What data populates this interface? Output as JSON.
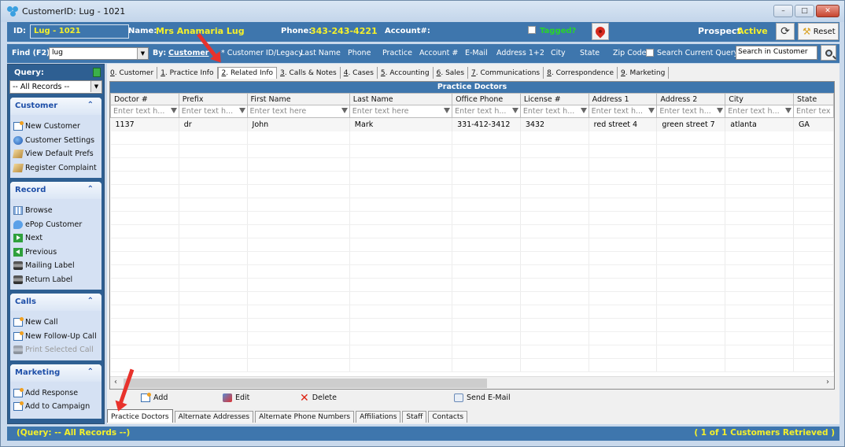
{
  "window": {
    "title": "CustomerID: Lug - 1021",
    "buttons": {
      "minimize": "–",
      "maximize": "□",
      "close": "✕"
    }
  },
  "infobar": {
    "id_label": "ID:",
    "id_value": "Lug - 1021",
    "name_label": "Name:",
    "name_value": "Mrs Anamaria Lug",
    "phone_label": "Phone:",
    "phone_value": "343-243-4221",
    "account_label": "Account#:",
    "account_value": "",
    "tagged_label": "Tagged?",
    "tagged_checked": false,
    "prospect_label": "Prospect",
    "status_value": "Active",
    "refresh_glyph": "⟳",
    "reset_label": "Reset"
  },
  "findbar": {
    "find_label": "Find (F2)",
    "find_value": "lug",
    "by_label": "By:",
    "by_value": "Customer",
    "fields": [
      "* Customer ID/Legacy",
      "Last Name",
      "Phone",
      "Practice",
      "Account #",
      "E-Mail",
      "Address 1+2",
      "City",
      "State",
      "Zip Code"
    ],
    "search_current_query_label": "Search Current Query",
    "search_current_query_checked": false,
    "search_value": "Search in Customer"
  },
  "sidebar": {
    "query_label": "Query:",
    "query_value": "-- All Records --",
    "groups": [
      {
        "title": "Customer",
        "items": [
          {
            "label": "New Customer",
            "icon": "new-icon"
          },
          {
            "label": "Customer Settings",
            "icon": "globe-icon"
          },
          {
            "label": "View Default Prefs",
            "icon": "prefs-icon"
          },
          {
            "label": "Register Complaint",
            "icon": "complaint-icon"
          }
        ]
      },
      {
        "title": "Record",
        "items": [
          {
            "label": "Browse",
            "icon": "grid-icon"
          },
          {
            "label": "ePop Customer",
            "icon": "chat-bubble-icon"
          },
          {
            "label": "Next",
            "icon": "next-icon"
          },
          {
            "label": "Previous",
            "icon": "previous-icon"
          },
          {
            "label": "Mailing Label",
            "icon": "printer-icon"
          },
          {
            "label": "Return Label",
            "icon": "printer-icon"
          }
        ]
      },
      {
        "title": "Calls",
        "items": [
          {
            "label": "New Call",
            "icon": "new-icon"
          },
          {
            "label": "New Follow-Up Call",
            "icon": "new-icon"
          },
          {
            "label": "Print Selected Call",
            "icon": "printer-icon",
            "disabled": true
          }
        ]
      },
      {
        "title": "Marketing",
        "items": [
          {
            "label": "Add Response",
            "icon": "new-icon"
          },
          {
            "label": "Add to Campaign",
            "icon": "new-icon"
          }
        ]
      }
    ]
  },
  "tabs": [
    {
      "key": "0",
      "label": ". Customer"
    },
    {
      "key": "1",
      "label": ". Practice Info"
    },
    {
      "key": "2",
      "label": ". Related Info",
      "active": true
    },
    {
      "key": "3",
      "label": ". Calls & Notes"
    },
    {
      "key": "4",
      "label": ". Cases"
    },
    {
      "key": "5",
      "label": ". Accounting"
    },
    {
      "key": "6",
      "label": ". Sales"
    },
    {
      "key": "7",
      "label": ". Communications"
    },
    {
      "key": "8",
      "label": ". Correspondence"
    },
    {
      "key": "9",
      "label": ". Marketing"
    }
  ],
  "grid": {
    "title": "Practice Doctors",
    "columns": [
      "Doctor #",
      "Prefix",
      "First Name",
      "Last Name",
      "Office Phone",
      "License #",
      "Address 1",
      "Address 2",
      "City",
      "State"
    ],
    "filters": [
      "Enter text h...",
      "Enter text h...",
      "Enter text here",
      "Enter text here",
      "Enter text h...",
      "Enter text h...",
      "Enter text h...",
      "Enter text h...",
      "Enter text h...",
      "Enter tex"
    ],
    "rows": [
      [
        "1137",
        "dr",
        "John",
        "Mark",
        "331-412-3412",
        "3432",
        "red street 4",
        "green street 7",
        "atlanta",
        "GA"
      ]
    ]
  },
  "actions": {
    "add": "Add",
    "edit": "Edit",
    "delete": "Delete",
    "send_email": "Send E-Mail"
  },
  "bottom_tabs": [
    {
      "label": "Practice Doctors",
      "active": true
    },
    {
      "label": "Alternate Addresses"
    },
    {
      "label": "Alternate Phone Numbers"
    },
    {
      "label": "Affiliations"
    },
    {
      "label": "Staff"
    },
    {
      "label": "Contacts"
    }
  ],
  "statusbar": {
    "left": "(Query: -- All Records --)",
    "right": "( 1 of 1 Customers Retrieved )"
  }
}
